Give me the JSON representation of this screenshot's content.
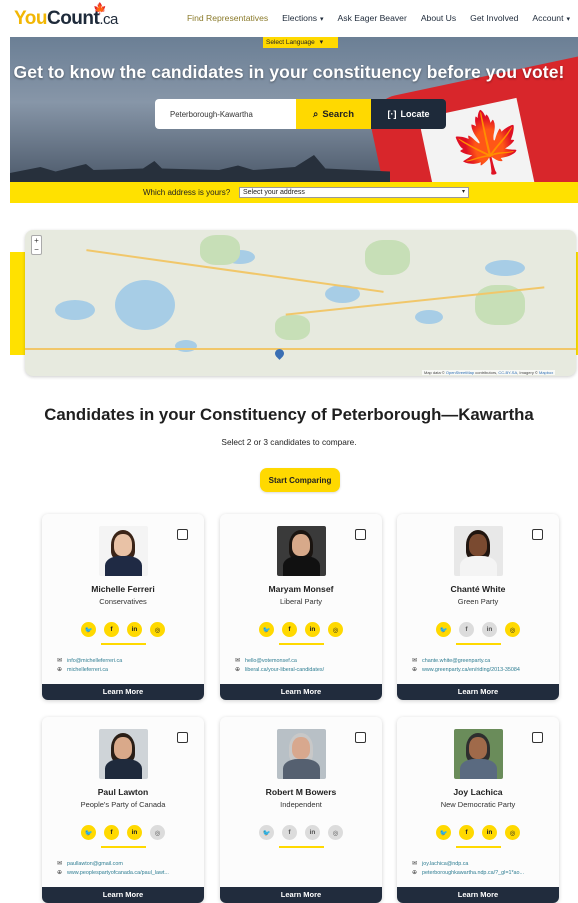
{
  "nav": {
    "logo_you": "You",
    "logo_count": "Count",
    "logo_ca": ".ca",
    "links": [
      {
        "label": "Find Representatives",
        "active": true,
        "dropdown": false
      },
      {
        "label": "Elections",
        "active": false,
        "dropdown": true
      },
      {
        "label": "Ask Eager Beaver",
        "active": false,
        "dropdown": false
      },
      {
        "label": "About Us",
        "active": false,
        "dropdown": false
      },
      {
        "label": "Get Involved",
        "active": false,
        "dropdown": false
      },
      {
        "label": "Account",
        "active": false,
        "dropdown": true
      }
    ]
  },
  "hero": {
    "language_label": "Select Language",
    "title": "Get to know the candidates in your constituency before you vote!",
    "search_value": "Peterborough-Kawartha",
    "search_label": "Search",
    "locate_label": "Locate",
    "address_prompt": "Which address is yours?",
    "address_select": "Select your address"
  },
  "map": {
    "zoom_in": "+",
    "zoom_out": "−",
    "attribution_prefix": "Map data ©",
    "attribution_osm": "OpenStreetMap",
    "attribution_mid": "contributors,",
    "attribution_cc": "CC-BY-SA",
    "attribution_imagery": ", Imagery ©",
    "attribution_mapbox": "Mapbox"
  },
  "candidates": {
    "title": "Candidates in your Constituency of Peterborough—Kawartha",
    "subtitle": "Select 2 or 3 candidates to compare.",
    "compare_label": "Start Comparing",
    "learn_more": "Learn More",
    "list": [
      {
        "name": "Michelle Ferreri",
        "party": "Conservatives",
        "email": "info@michelleferreri.ca",
        "website": "michelleferreri.ca",
        "socials_active": [
          true,
          true,
          true,
          true
        ]
      },
      {
        "name": "Maryam Monsef",
        "party": "Liberal Party",
        "email": "hello@votemonsef.ca",
        "website": "liberal.ca/your-liberal-candidates/",
        "socials_active": [
          true,
          true,
          true,
          true
        ]
      },
      {
        "name": "Chanté White",
        "party": "Green Party",
        "email": "chante.white@greenparty.ca",
        "website": "www.greenparty.ca/en/riding/2013-35084",
        "socials_active": [
          true,
          false,
          false,
          true
        ]
      },
      {
        "name": "Paul Lawton",
        "party": "People's Party of Canada",
        "email": "paullawton@gmail.com",
        "website": "www.peoplespartyofcanada.ca/paul_lawt...",
        "socials_active": [
          true,
          true,
          true,
          false
        ]
      },
      {
        "name": "Robert M Bowers",
        "party": "Independent",
        "email": "",
        "website": "",
        "socials_active": [
          false,
          false,
          false,
          false
        ]
      },
      {
        "name": "Joy Lachica",
        "party": "New Democratic Party",
        "email": "joy.lachica@ndp.ca",
        "website": "peterboroughkawartha.ndp.ca/?_gl=1*ao...",
        "socials_active": [
          true,
          true,
          true,
          true
        ]
      }
    ]
  },
  "social_icons": [
    "twitter-icon",
    "facebook-icon",
    "linkedin-icon",
    "instagram-icon"
  ],
  "social_glyphs": [
    "🐦",
    "f",
    "in",
    "◎"
  ],
  "colors": {
    "accent": "#ffd900",
    "navy": "#212c3d",
    "link": "#2e7d92"
  }
}
